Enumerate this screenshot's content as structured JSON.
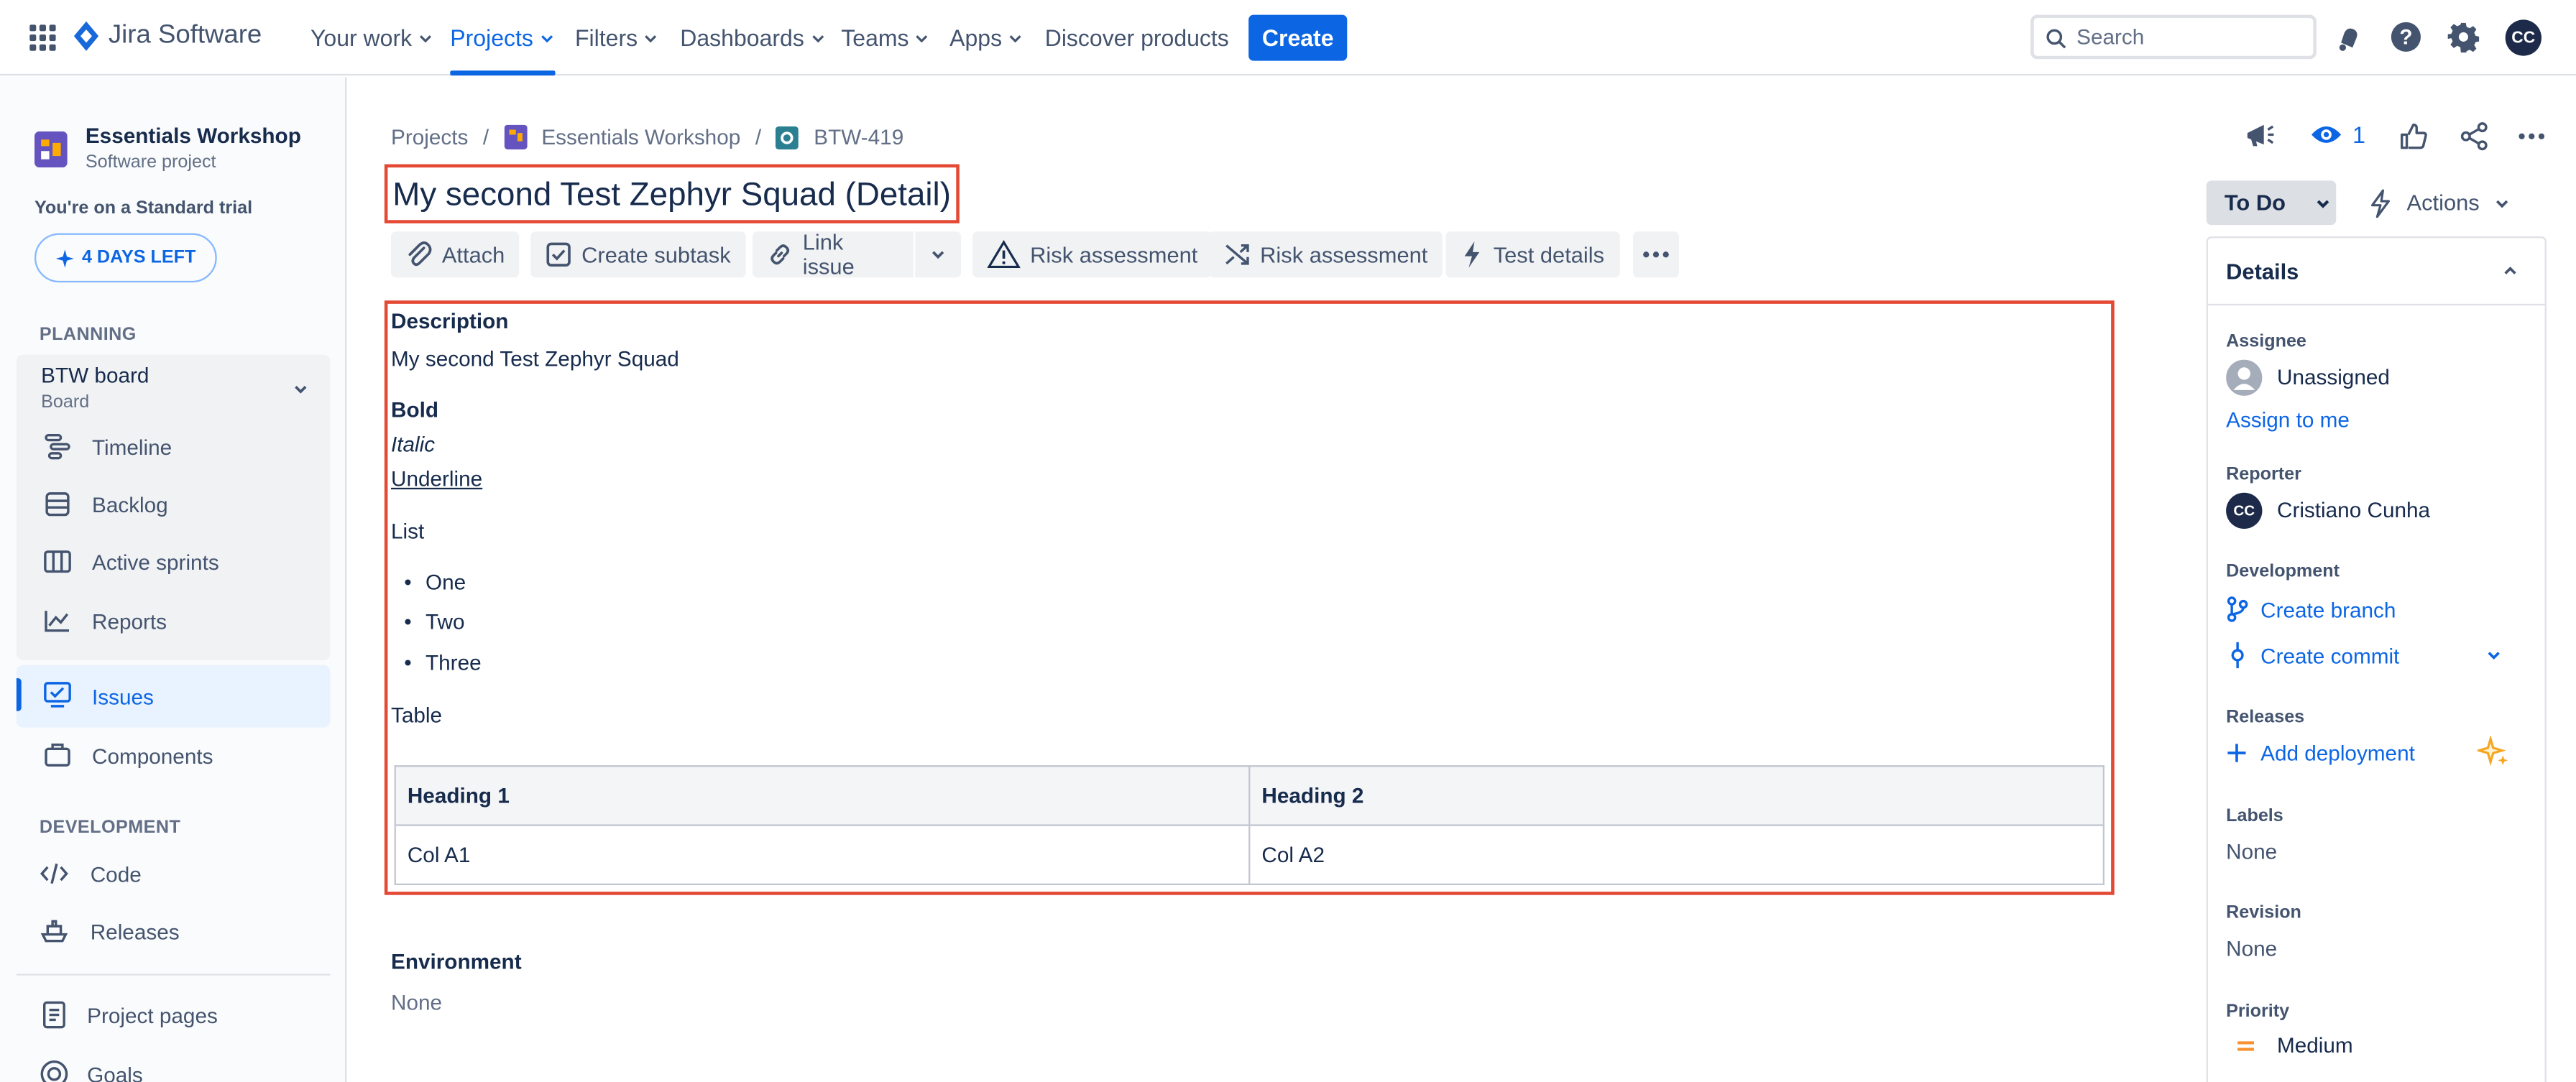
{
  "topnav": {
    "product": "Jira Software",
    "items": [
      "Your work",
      "Projects",
      "Filters",
      "Dashboards",
      "Teams",
      "Apps"
    ],
    "discover": "Discover products",
    "create": "Create",
    "search_placeholder": "Search",
    "avatar_initials": "CC",
    "brand_color": "#0c66e4"
  },
  "sidebar": {
    "project_name": "Essentials Workshop",
    "project_type": "Software project",
    "trial_text": "You're on a Standard trial",
    "trial_badge": "4 DAYS LEFT",
    "planning_header": "PLANNING",
    "board_name": "BTW board",
    "board_type": "Board",
    "planning_items": [
      "Timeline",
      "Backlog",
      "Active sprints",
      "Reports"
    ],
    "issues": "Issues",
    "components": "Components",
    "development_header": "DEVELOPMENT",
    "dev_items": [
      "Code",
      "Releases"
    ],
    "project_pages": "Project pages",
    "goals": "Goals"
  },
  "breadcrumb": {
    "projects": "Projects",
    "project": "Essentials Workshop",
    "issue_key": "BTW-419"
  },
  "issue": {
    "title": "My second Test Zephyr Squad (Detail)",
    "toolbar": {
      "attach": "Attach",
      "create_subtask": "Create subtask",
      "link_issue": "Link issue",
      "risk_assessment_1": "Risk assessment",
      "risk_assessment_2": "Risk assessment",
      "test_details": "Test details"
    },
    "description": {
      "label": "Description",
      "line1": "My second Test Zephyr Squad",
      "bold": "Bold",
      "italic": "Italic",
      "underline": "Underline",
      "list_label": "List",
      "list_items": [
        "One",
        "Two",
        "Three"
      ],
      "table_label": "Table",
      "table": {
        "headers": [
          "Heading 1",
          "Heading 2"
        ],
        "rows": [
          [
            "Col A1",
            "Col A2"
          ]
        ]
      }
    },
    "environment_label": "Environment",
    "environment_value": "None"
  },
  "header_actions": {
    "watch_count": "1"
  },
  "status": {
    "value": "To Do",
    "actions": "Actions"
  },
  "details": {
    "header": "Details",
    "assignee_label": "Assignee",
    "assignee_value": "Unassigned",
    "assign_to_me": "Assign to me",
    "reporter_label": "Reporter",
    "reporter_value": "Cristiano Cunha",
    "reporter_initials": "CC",
    "development_label": "Development",
    "create_branch": "Create branch",
    "create_commit": "Create commit",
    "releases_label": "Releases",
    "add_deployment": "Add deployment",
    "labels_label": "Labels",
    "labels_value": "None",
    "revision_label": "Revision",
    "revision_value": "None",
    "priority_label": "Priority",
    "priority_value": "Medium"
  }
}
